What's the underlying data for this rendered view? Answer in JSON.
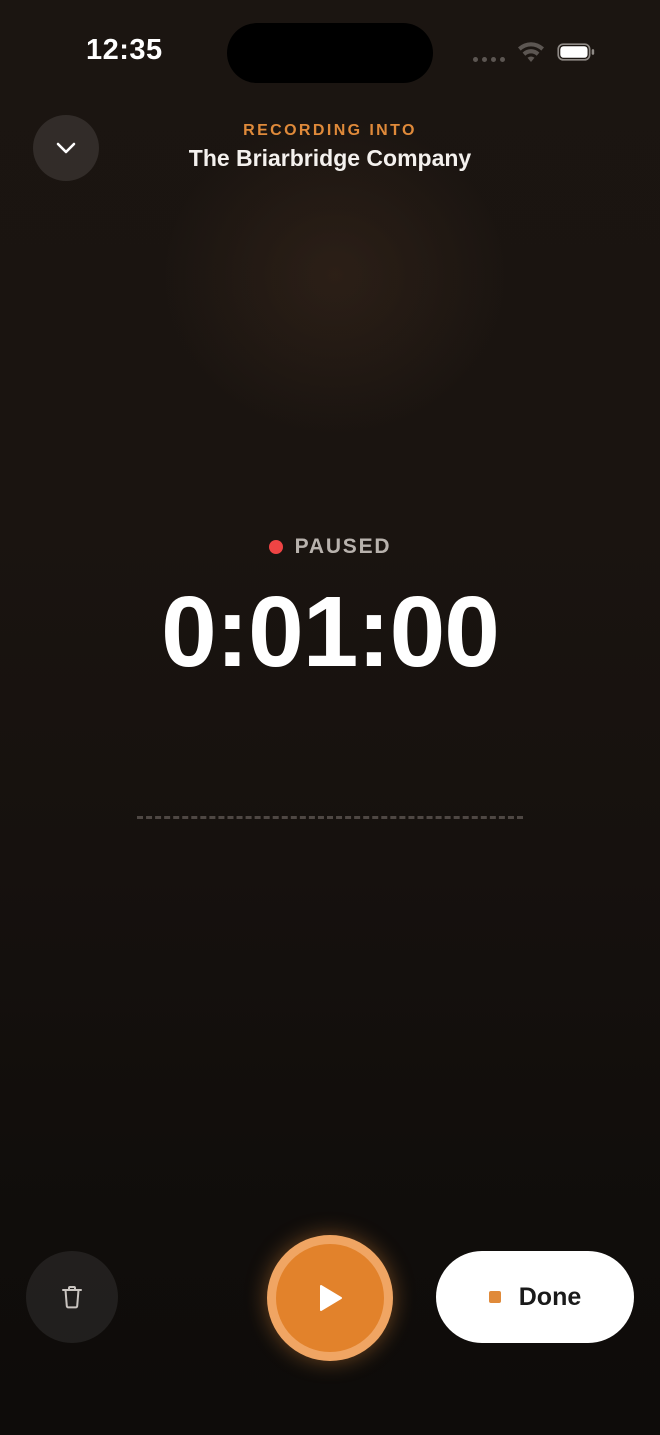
{
  "status_bar": {
    "time": "12:35"
  },
  "header": {
    "kicker": "RECORDING INTO",
    "title": "The Briarbridge Company"
  },
  "recorder": {
    "state": "PAUSED",
    "elapsed": "0:01:00"
  },
  "controls": {
    "done_label": "Done"
  },
  "colors": {
    "accent": "#e08a3a",
    "paused_dot": "#ef4444",
    "background": "#17120f"
  },
  "icons": {
    "collapse": "chevron-down-icon",
    "delete": "trash-icon",
    "play": "play-icon",
    "stop": "stop-icon"
  }
}
